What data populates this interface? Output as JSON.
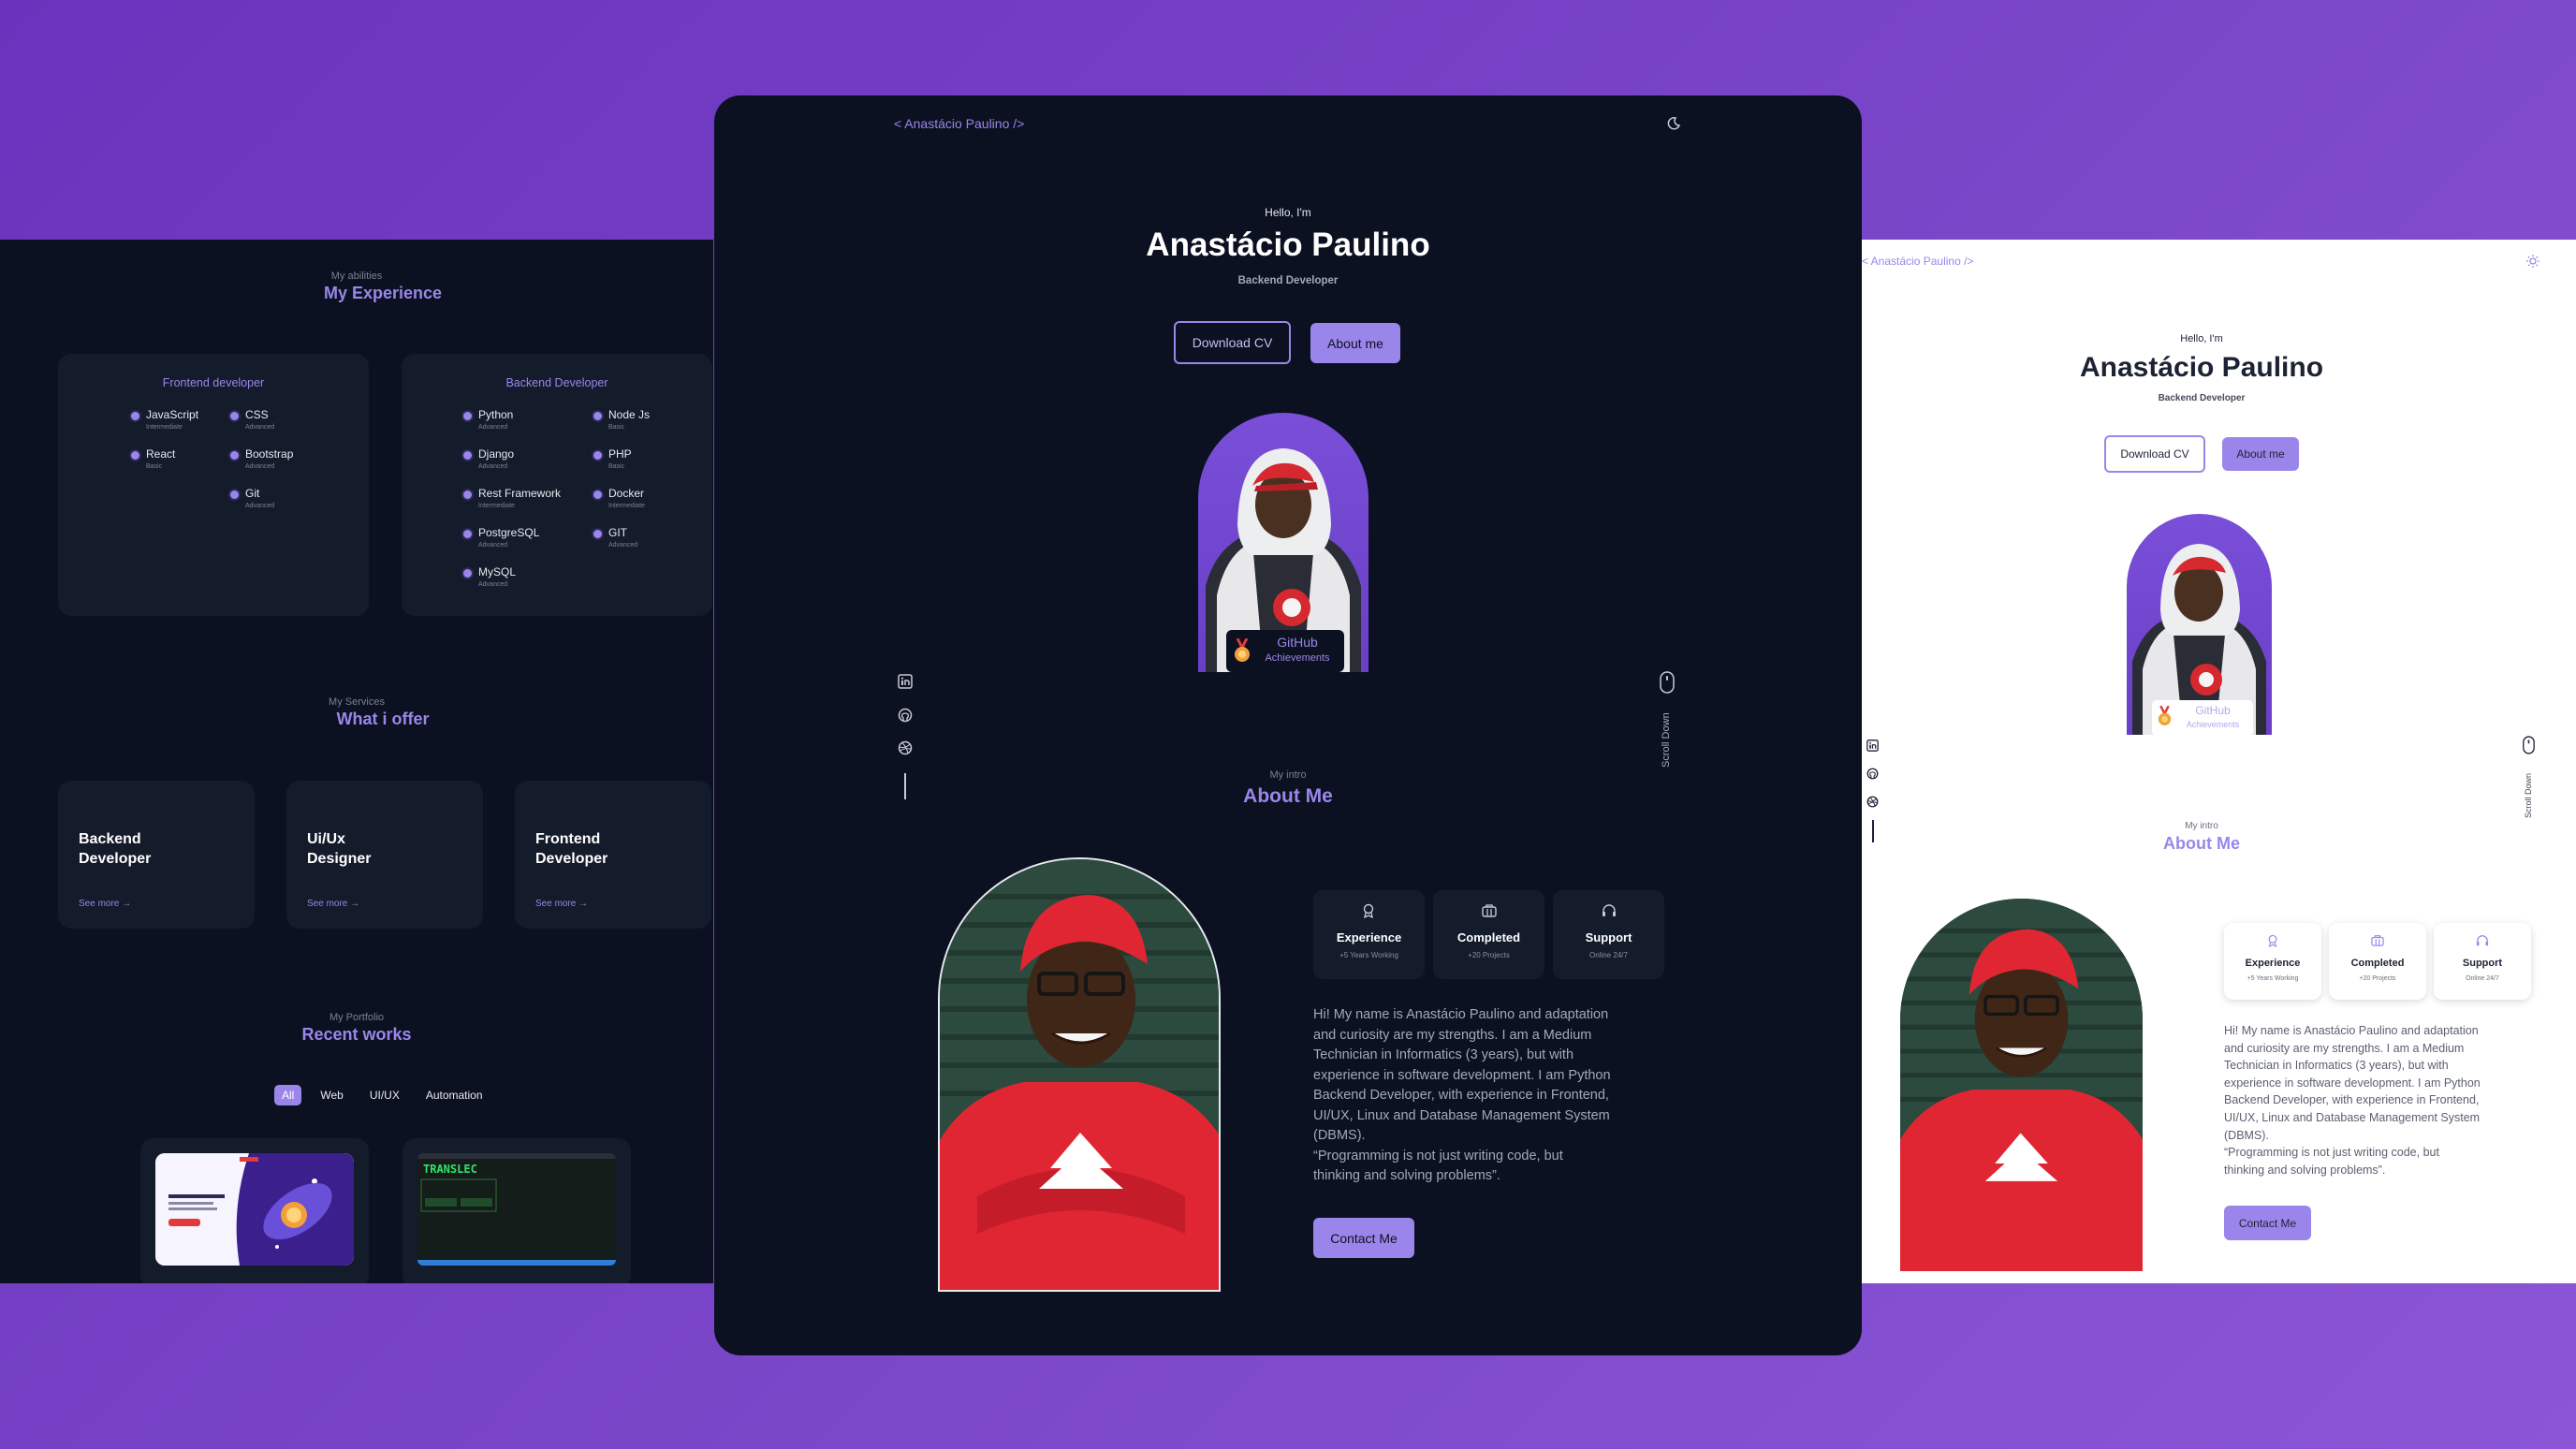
{
  "left": {
    "experience": {
      "subtitle": "My abilities",
      "title": "My Experience",
      "frontend": {
        "title": "Frontend developer",
        "skills": [
          {
            "name": "JavaScript",
            "level": "Intermediate"
          },
          {
            "name": "CSS",
            "level": "Advanced"
          },
          {
            "name": "React",
            "level": "Basic"
          },
          {
            "name": "Bootstrap",
            "level": "Advanced"
          },
          {
            "name": "Git",
            "level": "Advanced"
          }
        ]
      },
      "backend": {
        "title": "Backend Developer",
        "skills": [
          {
            "name": "Python",
            "level": "Advanced"
          },
          {
            "name": "Node Js",
            "level": "Basic"
          },
          {
            "name": "Django",
            "level": "Advanced"
          },
          {
            "name": "PHP",
            "level": "Basic"
          },
          {
            "name": "Rest Framework",
            "level": "Intermediate"
          },
          {
            "name": "Docker",
            "level": "Intermediate"
          },
          {
            "name": "PostgreSQL",
            "level": "Advanced"
          },
          {
            "name": "GIT",
            "level": "Advanced"
          },
          {
            "name": "MySQL",
            "level": "Advanced"
          }
        ]
      }
    },
    "services": {
      "subtitle": "My Services",
      "title": "What i offer",
      "cards": [
        {
          "line1": "Backend",
          "line2": "Developer",
          "more": "See more →"
        },
        {
          "line1": "Ui/Ux",
          "line2": "Designer",
          "more": "See more →"
        },
        {
          "line1": "Frontend",
          "line2": "Developer",
          "more": "See more →"
        }
      ]
    },
    "portfolio": {
      "subtitle": "My Portfolio",
      "title": "Recent works",
      "filters": [
        "All",
        "Web",
        "UI/UX",
        "Automation"
      ],
      "thumb2_text": "TRANSLEC"
    }
  },
  "center": {
    "logo": "< Anastácio Paulino />",
    "greeting": "Hello, I'm",
    "name": "Anastácio Paulino",
    "role": "Backend Developer",
    "download_cv": "Download CV",
    "about_me_btn": "About me",
    "badge_title": "GitHub",
    "badge_sub": "Achievements",
    "scroll_label": "Scroll Down",
    "about_subtitle": "My intro",
    "about_title": "About Me",
    "stats": [
      {
        "title": "Experience",
        "sub": "+5 Years Working",
        "icon": "award-icon"
      },
      {
        "title": "Completed",
        "sub": "+20 Projects",
        "icon": "briefcase-icon"
      },
      {
        "title": "Support",
        "sub": "Online 24/7",
        "icon": "headset-icon"
      }
    ],
    "about_lines": [
      "Hi! My name is Anastácio Paulino and adaptation",
      "and curiosity are my strengths. I am a Medium",
      "Technician in Informatics (3 years), but with",
      "experience in software development. I am Python",
      "Backend Developer, with experience in Frontend,",
      "UI/UX, Linux and Database Management System",
      "(DBMS).",
      "“Programming is not just writing code, but",
      "thinking and solving problems”."
    ],
    "contact_btn": "Contact Me"
  },
  "right": {
    "logo": "< Anastácio Paulino />",
    "greeting": "Hello, I'm",
    "name": "Anastácio Paulino",
    "role": "Backend Developer",
    "download_cv": "Download CV",
    "about_me_btn": "About me",
    "badge_title": "GitHub",
    "badge_sub": "Achievements",
    "scroll_label": "Scroll Down",
    "about_subtitle": "My intro",
    "about_title": "About Me",
    "stats": [
      {
        "title": "Experience",
        "sub": "+5 Years Working",
        "icon": "award-icon"
      },
      {
        "title": "Completed",
        "sub": "+20 Projects",
        "icon": "briefcase-icon"
      },
      {
        "title": "Support",
        "sub": "Online 24/7",
        "icon": "headset-icon"
      }
    ],
    "about_lines": [
      "Hi! My name is Anastácio Paulino and adaptation",
      "and curiosity are my strengths. I am a Medium",
      "Technician in Informatics (3 years), but with",
      "experience in software development. I am Python",
      "Backend Developer, with experience in Frontend,",
      "UI/UX, Linux and Database Management System",
      "(DBMS).",
      "“Programming is not just writing code, but",
      "thinking and solving problems”."
    ],
    "contact_btn": "Contact Me"
  },
  "colors": {
    "accent": "#9a86ea",
    "dark_bg": "#0b1120",
    "card_bg": "#141b2b",
    "light_bg": "#ffffff",
    "backdrop": "#7b47c9"
  }
}
